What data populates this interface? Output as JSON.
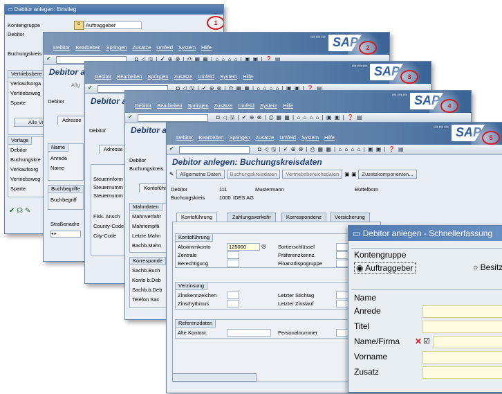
{
  "menu": [
    "Debitor",
    "Bearbeiten",
    "Springen",
    "Zusätze",
    "Umfeld",
    "System",
    "Hilfe"
  ],
  "sap_logo": "SAP",
  "toolbar_icons": "◘ ◁ 🖫 | ✔ ⊕ ⊗ | ⎙ ▦ ▦ | ⌂ ⌂ ⌂ ⌂ | ▣ ▣ | ❓ ▤",
  "win1": {
    "title": "Debitor anlegen: Einstieg",
    "badge": "1",
    "rows": [
      "Kontengruppe",
      "Debitor",
      "Buchungskreis",
      "Vertriebsbere",
      "Verkaufsorga",
      "Vertriebsweg",
      "Sparte"
    ],
    "kontengruppe_value": "Auftraggeber",
    "button": "Alle Vert",
    "vorlage_head": "Vorlage",
    "vorlage_rows": [
      "Debitor",
      "Buchungskre",
      "Verkaufsorg",
      "Vertriebsweg",
      "Sparte"
    ],
    "vertriebs_head": "Vertriebsbere"
  },
  "win2": {
    "title": "Debitor an",
    "badge": "2",
    "toolbar_text": "Allg",
    "label_debitor": "Debitor",
    "tab": "Adresse",
    "name_head": "Name",
    "name_rows": [
      "Anrede",
      "Name"
    ],
    "search_rows": [
      "Buchbegriffe",
      "Buchbegriff"
    ],
    "street": "Straßenadre"
  },
  "win3": {
    "title": "Debitor a",
    "badge": "3",
    "label_debitor": "Debitor",
    "tab": "Adresse",
    "steuer_head": "Steuerinform",
    "steuer_rows": [
      "Steuernumm",
      "Steuernumm"
    ],
    "extra_rows": [
      "Fisk. Ansch",
      "County-Code",
      "City-Code"
    ]
  },
  "win4": {
    "title": "Debitor a",
    "badge": "4",
    "labels": [
      "Debitor",
      "Buchungskreis"
    ],
    "tab": "Kontoführ",
    "mahn_head": "Mahndaten",
    "mahn_rows": [
      "Mahnverfahr",
      "Mahnempfä",
      "Letzte Mahn",
      "Bachb.Mahn"
    ],
    "korr_head": "Korresponde",
    "korr_rows": [
      "Sachb.Buch",
      "Konto b.Deb",
      "Sachb.b.Deb",
      "Telefon Sac"
    ]
  },
  "win5": {
    "title": "Debitor anlegen: Buchungskreisdaten",
    "badge": "5",
    "buttons": [
      "Allgemeine Daten",
      "Buchungskreisdaten",
      "Vertriebsbereichsdaten",
      "Zusatzkomponenten..."
    ],
    "debitor_label": "Debitor",
    "debitor_value": "111",
    "debitor_name": "Mustermann",
    "debitor_city": "Büttelborn",
    "bukrs_label": "Buchungskreis",
    "bukrs_value": "1000",
    "bukrs_name": "IDES AG",
    "tabs": [
      "Kontoführung",
      "Zahlungsverkehr",
      "Korrespondenz",
      "Versicherung"
    ],
    "kf_head": "Kontoführung",
    "kf_left": [
      "Abstimmkonto",
      "Zentrale",
      "Berechtigung"
    ],
    "abstimmkonto_value": "125000",
    "kf_right": [
      "Sortierschlüssel",
      "Präferenzkennz.",
      "Finanzdispogruppe"
    ],
    "verz_head": "Verzinsung",
    "verz_left": [
      "Zinskennzeichen",
      "Zinsrhythmus"
    ],
    "verz_right": [
      "Letzter Stichtag",
      "Letzter Zinslauf"
    ],
    "ref_head": "Referenzdaten",
    "ref_left": "Alte Kontonr.",
    "ref_right": "Personalnummer"
  },
  "popup": {
    "title": "Debitor anlegen - Schnellerfassung",
    "kontengruppe_head": "Kontengruppe",
    "radio1": "Auftraggeber",
    "radio2": "Besitz",
    "name_head": "Name",
    "rows": [
      "Anrede",
      "Titel",
      "Name/Firma",
      "Vorname",
      "Zusatz"
    ]
  },
  "colors": {
    "sap_blue": "#3d6aa3",
    "badge_red": "#d8191d",
    "required_field": "#fffbe0"
  }
}
